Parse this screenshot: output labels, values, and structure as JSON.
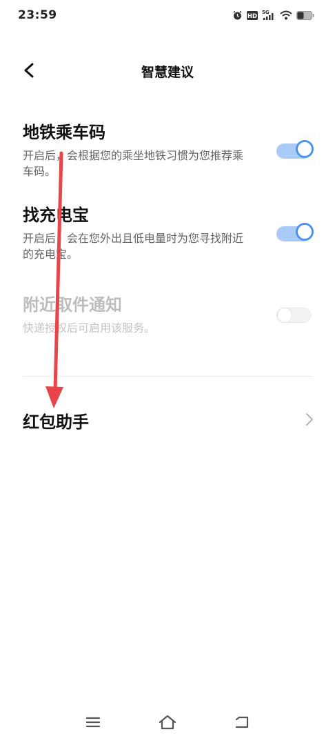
{
  "status_bar": {
    "time": "23:59",
    "network": "5G",
    "hd": "HD"
  },
  "header": {
    "title": "智慧建议"
  },
  "settings": [
    {
      "title": "地铁乘车码",
      "description": "开启后，会根据您的乘坐地铁习惯为您推荐乘车码。",
      "enabled": true,
      "available": true
    },
    {
      "title": "找充电宝",
      "description": "开启后，会在您外出且低电量时为您寻找附近的充电宝。",
      "enabled": true,
      "available": true
    },
    {
      "title": "附近取件通知",
      "description": "快递授权后可启用该服务。",
      "enabled": false,
      "available": false
    }
  ],
  "nav_item": {
    "label": "红包助手"
  },
  "colors": {
    "accent": "#4c94ef",
    "toggle_track_on": "#a9cbf5",
    "annotation_arrow": "#e8454a"
  },
  "icons": {
    "back": "back-arrow-icon",
    "chevron": "chevron-right-icon",
    "nav_menu": "menu-icon",
    "nav_home": "home-icon",
    "nav_back": "return-icon"
  }
}
